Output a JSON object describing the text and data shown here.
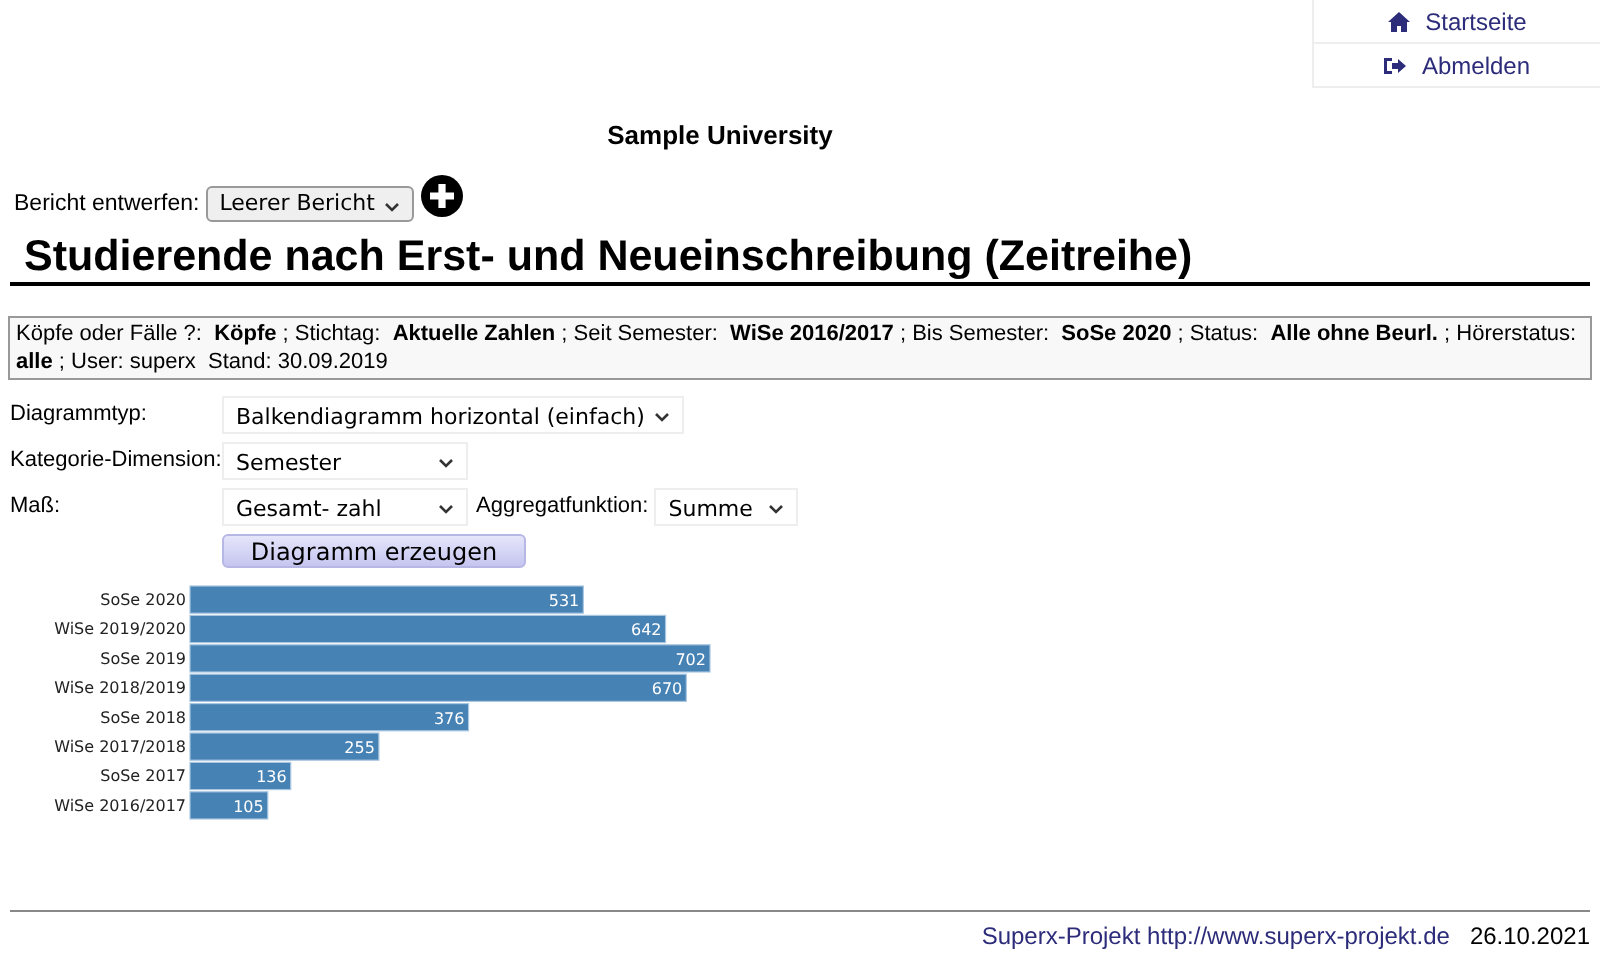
{
  "nav": [
    {
      "kind": "home",
      "label": "Startseite"
    },
    {
      "kind": "logout",
      "label": "Abmelden"
    }
  ],
  "site_title": "Sample University",
  "report": {
    "label": "Bericht entwerfen:",
    "value": "Leerer Bericht"
  },
  "heading": "Studierende nach Erst- und Neueinschreibung (Zeitreihe)",
  "filter_summary": "Köpfe oder Fälle ?:  **Köpfe** ; Stichtag:  **Aktuelle Zahlen** ; Seit Semester:  **WiSe 2016/2017** ; Bis Semester:  **SoSe 2020** ; Status:  **Alle ohne Beurl.** ; Hörerstatus:  **alle** ; User: superx  Stand: 30.09.2019",
  "form": [
    {
      "label": "Diagrammtyp:",
      "value": "Balkendiagramm horizontal (einfach)"
    },
    {
      "label": "Kategorie-Dimension:",
      "value": "Semester"
    },
    {
      "label": "Maß:",
      "value": "Gesamt- zahl",
      "extra_label": "Aggregatfunktion:",
      "extra_value": "Summe"
    }
  ],
  "submit_button": "Diagramm erzeugen",
  "chart_data": {
    "type": "bar",
    "orientation": "horizontal",
    "data_labels": true,
    "categories": [
      "SoSe 2020",
      "WiSe 2019/2020",
      "SoSe 2019",
      "WiSe 2018/2019",
      "SoSe 2018",
      "WiSe 2017/2018",
      "SoSe 2017",
      "WiSe 2016/2017"
    ],
    "values": [
      531,
      642,
      702,
      670,
      376,
      255,
      136,
      105
    ]
  },
  "footer": {
    "link": "Superx-Projekt http://www.superx-projekt.de",
    "date": "26.10.2021"
  }
}
